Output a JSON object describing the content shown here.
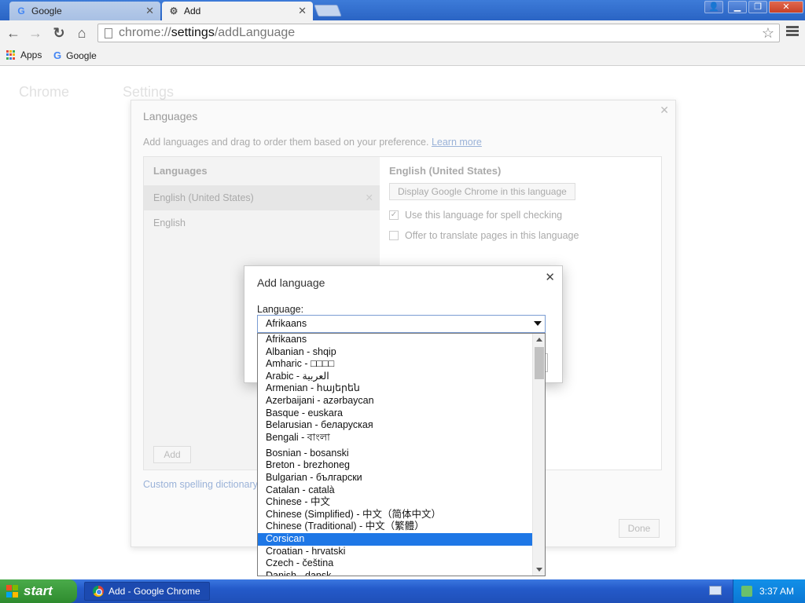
{
  "browser": {
    "tabs": [
      {
        "title": "Google",
        "favicon": "google-g-icon",
        "active": false
      },
      {
        "title": "Add",
        "favicon": "gear-icon",
        "active": true
      }
    ],
    "url": {
      "scheme": "chrome://",
      "host": "settings",
      "path": "/addLanguage"
    },
    "bookmarks": [
      {
        "label": "Apps",
        "icon": "apps-grid-icon"
      },
      {
        "label": "Google",
        "icon": "google-g-icon"
      }
    ]
  },
  "settings": {
    "sidebar_title": "Chrome",
    "page_title": "Settings"
  },
  "languages_dialog": {
    "title": "Languages",
    "description": "Add languages and drag to order them based on your preference.",
    "learn_more": "Learn more",
    "list_header": "Languages",
    "languages": [
      "English (United States)",
      "English"
    ],
    "add_button": "Add",
    "selected_header": "English (United States)",
    "display_button": "Display Google Chrome in this language",
    "spell_check": "Use this language for spell checking",
    "offer_translate": "Offer to translate pages in this language",
    "custom_dictionary": "Custom spelling dictionary",
    "done_button": "Done"
  },
  "add_language_dialog": {
    "title": "Add language",
    "label": "Language:",
    "selected": "Afrikaans",
    "options": [
      "Afrikaans",
      "Albanian - shqip",
      "Amharic - □□□□",
      "Arabic - العربية",
      "Armenian - հայերեն",
      "Azerbaijani - azərbaycan",
      "Basque - euskara",
      "Belarusian - беларуская",
      "Bengali - বাংলা",
      "Bosnian - bosanski",
      "Breton - brezhoneg",
      "Bulgarian - български",
      "Catalan - català",
      "Chinese - 中文",
      "Chinese (Simplified) - 中文（简体中文）",
      "Chinese (Traditional) - 中文（繁體）",
      "Corsican",
      "Croatian - hrvatski",
      "Czech - čeština",
      "Danish - dansk"
    ],
    "highlighted": "Corsican"
  },
  "taskbar": {
    "start_label": "start",
    "task_item": "Add - Google Chrome",
    "clock": "3:37 AM"
  }
}
